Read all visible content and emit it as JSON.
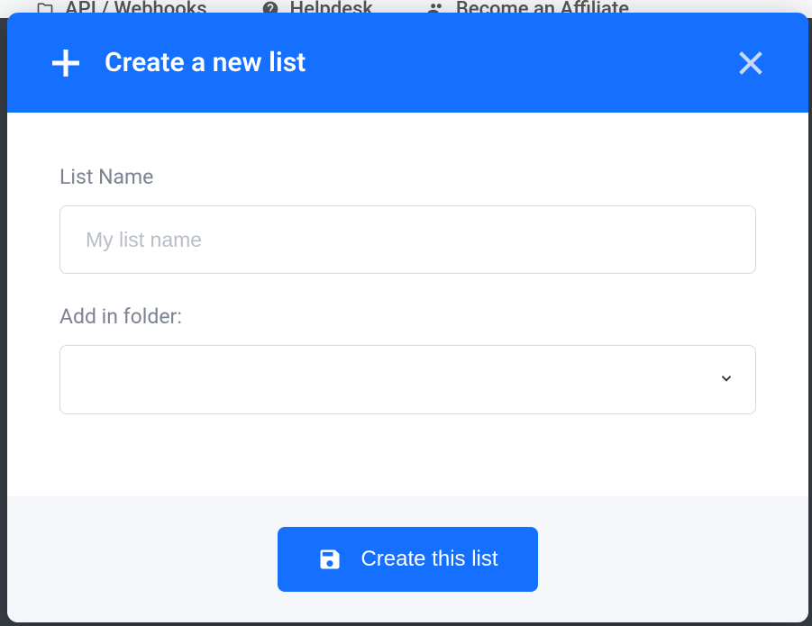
{
  "background_nav": {
    "item1": "API / Webhooks",
    "item2": "Helpdesk",
    "item3": "Become an Affiliate"
  },
  "modal": {
    "title": "Create a new list",
    "form": {
      "list_name_label": "List Name",
      "list_name_placeholder": "My list name",
      "list_name_value": "",
      "folder_label": "Add in folder:",
      "folder_value": ""
    },
    "footer": {
      "create_button_label": "Create this list"
    }
  }
}
